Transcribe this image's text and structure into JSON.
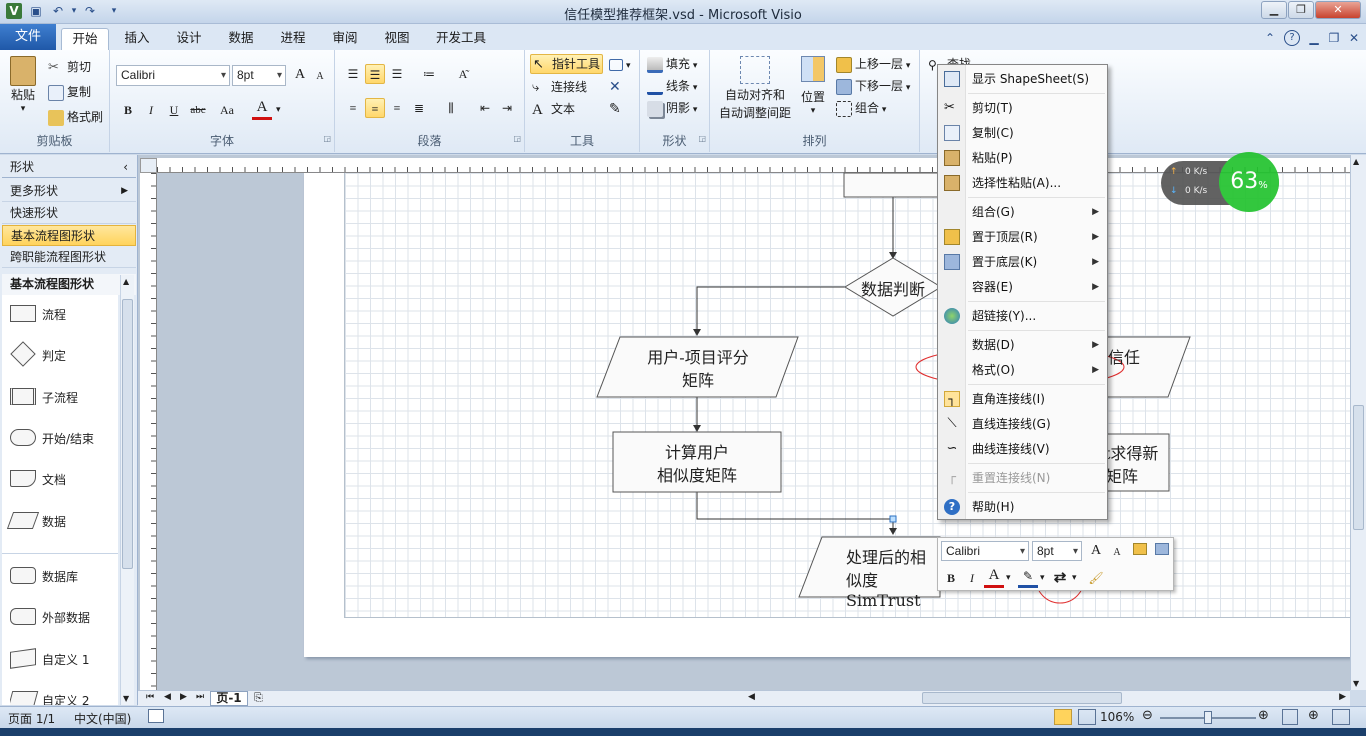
{
  "window": {
    "title": "信任模型推荐框架.vsd - Microsoft Visio",
    "help_glyph": "?",
    "min_glyph": "▁",
    "max_glyph": "❐",
    "close_glyph": "✕"
  },
  "ribbon_tabs": {
    "file": "文件",
    "tabs": [
      "开始",
      "插入",
      "设计",
      "数据",
      "进程",
      "审阅",
      "视图",
      "开发工具"
    ]
  },
  "ribbon": {
    "clipboard": {
      "label": "剪贴板",
      "paste": "粘贴",
      "cut": "剪切",
      "copy": "复制",
      "format_painter": "格式刷"
    },
    "font": {
      "label": "字体",
      "font_name": "Calibri",
      "font_size": "8pt",
      "bold": "B",
      "italic": "I",
      "underline": "U",
      "strike": "abc",
      "case": "Aa",
      "color": "A",
      "grow": "A",
      "shrink": "A"
    },
    "paragraph": {
      "label": "段落"
    },
    "tools": {
      "label": "工具",
      "pointer": "指针工具",
      "connector": "连接线",
      "text": "文本"
    },
    "shape": {
      "label": "形状",
      "fill": "填充",
      "line": "线条",
      "shadow": "阴影"
    },
    "arrange": {
      "label": "排列",
      "auto_align_1": "自动对齐和",
      "auto_align_2": "自动调整间距",
      "position": "位置",
      "bring_forward": "上移一层",
      "send_backward": "下移一层",
      "group": "组合"
    },
    "editing": {
      "find": "查找"
    }
  },
  "shapes_panel": {
    "header": "形状",
    "more": "更多形状",
    "quick": "快速形状",
    "basic_flowchart": "基本流程图形状",
    "cross_functional": "跨职能流程图形状",
    "stencil_title": "基本流程图形状",
    "stencils": [
      "流程",
      "判定",
      "子流程",
      "开始/结束",
      "文档",
      "数据",
      "数据库",
      "外部数据",
      "自定义 1",
      "自定义 2"
    ]
  },
  "diagram": {
    "decision": "数据判断",
    "matrix_1": "用户-项目评分",
    "matrix_2": "矩阵",
    "similarity_1": "计算用户",
    "similarity_2": "相似度矩阵",
    "processed_1": "处理后的相",
    "processed_2": "似度SimTrust",
    "right_trust": "信任",
    "right_new_1": "t求得新",
    "right_new_2": "矩阵"
  },
  "context_menu": {
    "items": [
      {
        "label": "显示 ShapeSheet(S)",
        "icon": "shapesheet-icon"
      },
      {
        "label": "剪切(T)",
        "icon": "scissors-icon"
      },
      {
        "label": "复制(C)",
        "icon": "copy-icon"
      },
      {
        "label": "粘贴(P)",
        "icon": "paste-icon"
      },
      {
        "label": "选择性粘贴(A)...",
        "icon": "paste-special-icon"
      },
      {
        "label": "组合(G)",
        "icon": ""
      },
      {
        "label": "置于顶层(R)",
        "icon": "bring-front-icon"
      },
      {
        "label": "置于底层(K)",
        "icon": "send-back-icon"
      },
      {
        "label": "容器(E)",
        "icon": ""
      },
      {
        "label": "超链接(Y)...",
        "icon": "globe-icon"
      },
      {
        "label": "数据(D)",
        "icon": ""
      },
      {
        "label": "格式(O)",
        "icon": ""
      },
      {
        "label": "直角连接线(I)",
        "icon": "right-angle-connector-icon"
      },
      {
        "label": "直线连接线(G)",
        "icon": "straight-connector-icon"
      },
      {
        "label": "曲线连接线(V)",
        "icon": "curved-connector-icon"
      },
      {
        "label": "重置连接线(N)",
        "icon": "reset-connector-icon"
      },
      {
        "label": "帮助(H)",
        "icon": "help-icon"
      }
    ]
  },
  "mini_toolbar": {
    "font": "Calibri",
    "size": "8pt",
    "bold": "B",
    "italic": "I",
    "color": "A"
  },
  "speed_widget": {
    "up": "0 K/s",
    "down": "0 K/s",
    "percent": "63",
    "unit": "%"
  },
  "page_tab": "页-1",
  "status": {
    "page": "页面 1/1",
    "language": "中文(中国)",
    "zoom": "106%"
  },
  "colors": {
    "accent": "#1f58a8",
    "highlight": "#ffd35c",
    "speed_green": "#22c32e"
  }
}
